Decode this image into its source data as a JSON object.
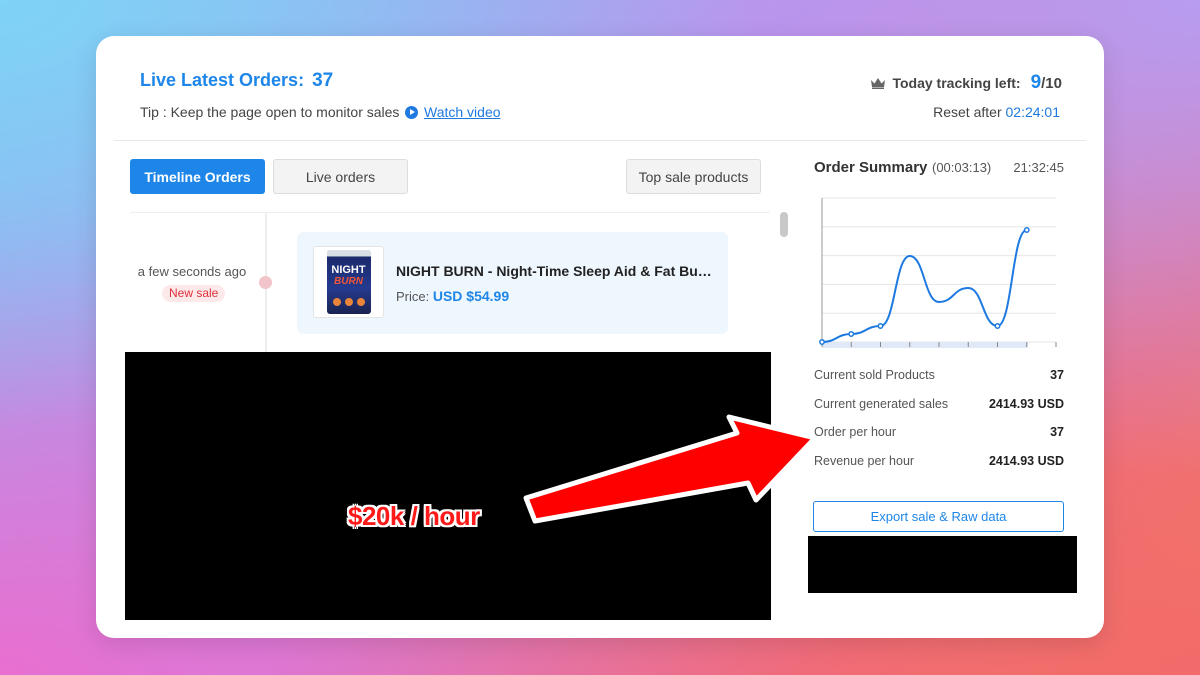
{
  "header": {
    "title": "Live Latest Orders:",
    "order_count": "37",
    "tip": "Tip : Keep the page open to monitor sales",
    "watch_video": "Watch video",
    "tracking_label": "Today tracking left:",
    "tracking_used": "9",
    "tracking_total": "/10",
    "reset_label": "Reset after",
    "reset_timer": "02:24:01"
  },
  "tabs": {
    "timeline": "Timeline Orders",
    "live": "Live orders",
    "top_sale": "Top sale products"
  },
  "timeline": [
    {
      "time": "a few seconds ago",
      "badge": "New sale",
      "product_name": "NIGHT BURN - Night-Time Sleep Aid & Fat Burn...",
      "price_label": "Price:",
      "price_value": "USD $54.99",
      "image_text_1": "NIGHT",
      "image_text_2": "BURN"
    }
  ],
  "summary": {
    "title": "Order Summary",
    "elapsed": "(00:03:13)",
    "clock": "21:32:45",
    "stats": [
      {
        "label": "Current sold Products",
        "value": "37"
      },
      {
        "label": "Current generated sales",
        "value": "2414.93 USD"
      },
      {
        "label": "Order per hour",
        "value": "37"
      },
      {
        "label": "Revenue per hour",
        "value": "2414.93 USD"
      }
    ],
    "export_button": "Export sale & Raw data"
  },
  "overlay": {
    "text": "$20k / hour",
    "arrow_color": "#ff0000"
  },
  "colors": {
    "primary": "#1e86e8",
    "new_sale": "#e0303c",
    "overlay_red": "#ff1a1a"
  },
  "chart_data": {
    "type": "line",
    "x": [
      0,
      1,
      2,
      3,
      4,
      5,
      6,
      7,
      8
    ],
    "values": [
      0,
      4,
      8,
      43,
      20,
      27,
      8,
      56,
      null
    ],
    "ylim": [
      0,
      72
    ],
    "grid": true,
    "title": "",
    "xlabel": "",
    "ylabel": ""
  }
}
